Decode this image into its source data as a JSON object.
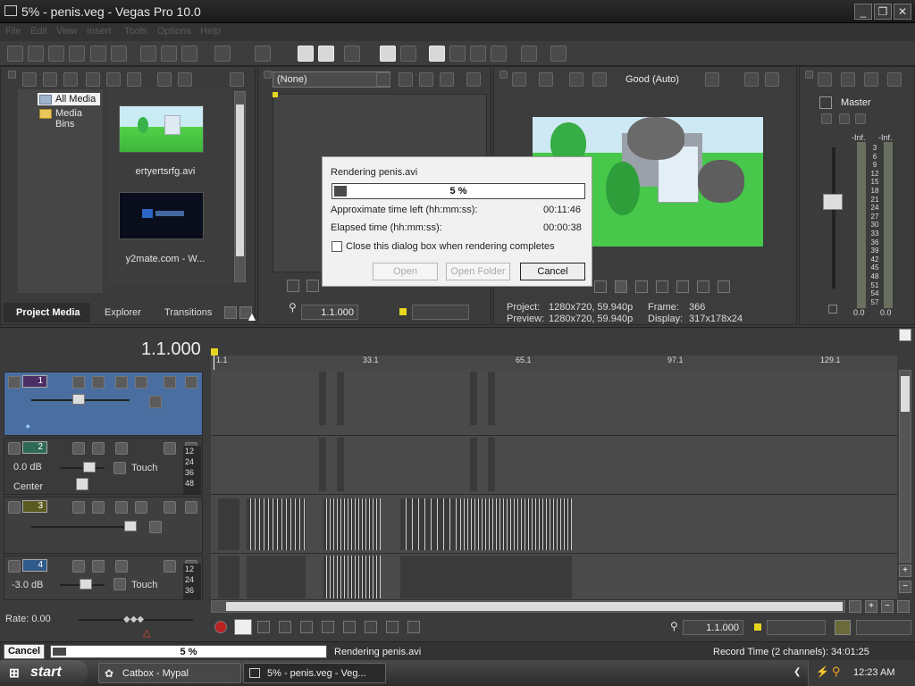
{
  "window": {
    "title": "5% - penis.veg - Vegas Pro 10.0"
  },
  "menubar": [
    "File",
    "Edit",
    "View",
    "Insert",
    "Tools",
    "Options",
    "Help"
  ],
  "project_media": {
    "tree": [
      "All Media",
      "Media Bins"
    ],
    "files": [
      "ertyertsrfg.avi",
      "y2mate.com - W..."
    ],
    "tabs": [
      "Project Media",
      "Explorer",
      "Transitions"
    ]
  },
  "trimmer": {
    "dropdown": "(None)",
    "timecode": "1.1.000"
  },
  "video_preview": {
    "quality": "Good (Auto)",
    "project_label": "Project:",
    "project_value": "1280x720, 59.940p",
    "preview_label": "Preview:",
    "preview_value": "1280x720, 59.940p",
    "frame_label": "Frame:",
    "frame_value": "366",
    "display_label": "Display:",
    "display_value": "317x178x24"
  },
  "master": {
    "label": "Master",
    "left": "-Inf.",
    "right": "-Inf.",
    "scale": [
      "3",
      "6",
      "9",
      "12",
      "15",
      "18",
      "21",
      "24",
      "27",
      "30",
      "33",
      "36",
      "39",
      "42",
      "45",
      "48",
      "51",
      "54",
      "57"
    ],
    "foot_left": "0.0",
    "foot_right": "0.0"
  },
  "render_dialog": {
    "title": "Rendering penis.avi",
    "progress_label": "5 %",
    "progress": 0.05,
    "time_left_label": "Approximate time left (hh:mm:ss):",
    "time_left": "00:11:46",
    "elapsed_label": "Elapsed time (hh:mm:ss):",
    "elapsed": "00:00:38",
    "checkbox_label": "Close this dialog box when rendering completes",
    "open": "Open",
    "open_folder": "Open Folder",
    "cancel": "Cancel"
  },
  "timeline": {
    "cursor": "1.1.000",
    "ruler": [
      "1.1",
      "33.1",
      "65.1",
      "97.1",
      "129.1"
    ],
    "tracks": [
      {
        "num": "1",
        "type": "video"
      },
      {
        "num": "2",
        "type": "audio",
        "volume": "0.0 dB",
        "pan": "Center",
        "mode": "Touch",
        "meter": [
          "12",
          "24",
          "36",
          "48"
        ]
      },
      {
        "num": "3",
        "type": "video"
      },
      {
        "num": "4",
        "type": "audio",
        "volume": "-3.0 dB",
        "mode": "Touch",
        "meter": [
          "12",
          "24",
          "36"
        ]
      }
    ],
    "rate": "Rate: 0.00",
    "transport_time": "1.1.000"
  },
  "statusbar": {
    "cancel": "Cancel",
    "progress_label": "5 %",
    "progress": 0.05,
    "message": "Rendering penis.avi",
    "record_time": "Record Time (2 channels): 34:01:25"
  },
  "taskbar": {
    "start": "start",
    "tasks": [
      "Catbox - Mypal",
      "5% - penis.veg - Veg..."
    ],
    "clock": "12:23 AM"
  }
}
